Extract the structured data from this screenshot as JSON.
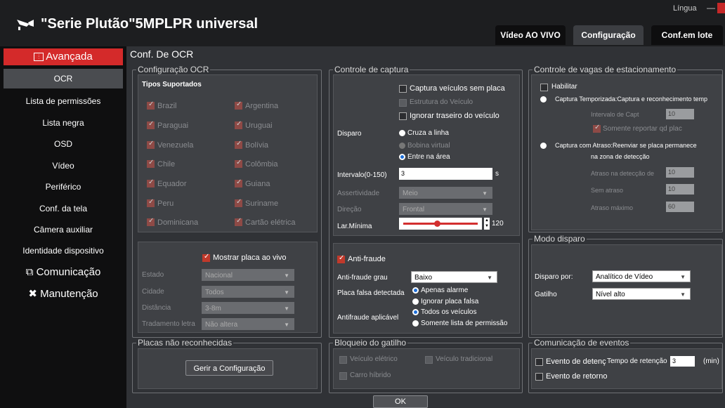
{
  "app": {
    "title": "\"Serie Plutão\"5MPLPR universal",
    "language": "Língua",
    "minimize": "—"
  },
  "tabs": [
    "Vídeo AO VIVO",
    "Configuração",
    "Conf.em lote"
  ],
  "sidebar": {
    "header": "Avançada",
    "items": [
      "OCR",
      "Lista de permissões",
      "Lista negra",
      "OSD",
      "Vídeo",
      "Periférico",
      "Conf. da tela",
      "Câmera auxiliar",
      "Identidade dispositivo",
      "Comunicação",
      "Manutenção"
    ]
  },
  "page_title": "Conf. De OCR",
  "ocr": {
    "group": "Configuração OCR",
    "types_label": "Tipos Suportados",
    "countries": [
      "Brazil",
      "Argentina",
      "Paraguai",
      "Uruguai",
      "Venezuela",
      "Bolívia",
      "Chile",
      "Colômbia",
      "Equador",
      "Guiana",
      "Peru",
      "Suriname",
      "Dominicana",
      "Cartão elétrica"
    ],
    "show_plate": "Mostrar placa ao vivo",
    "estado_label": "Estado",
    "estado_value": "Nacional",
    "cidade_label": "Cidade",
    "cidade_value": "Todos",
    "distancia_label": "Distância",
    "distancia_value": "3-8m",
    "tratamento_label": "Tradamento letra",
    "tratamento_value": "Não altera"
  },
  "unrecognized": {
    "group": "Placas não reconhecidas",
    "button": "Gerir a Configuração"
  },
  "capture": {
    "group": "Controle de captura",
    "no_plate": "Captura veículos sem placa",
    "vehicle_structure": "Estrutura do Veículo",
    "ignore_rear": "Ignorar traseiro do veículo",
    "trigger_label": "Disparo",
    "trigger_options": [
      "Cruza a linha",
      "Bobina virtual",
      "Entre na área"
    ],
    "interval_label": "Intervalo(0-150)",
    "interval_value": "3",
    "interval_unit": "s",
    "assert_label": "Assertividade",
    "assert_value": "Meio",
    "direction_label": "Direção",
    "direction_value": "Frontal",
    "minwidth_label": "Lar.Mínima",
    "minwidth_value": "120",
    "minwidth_slider": 0.45
  },
  "antifraud": {
    "label": "Anti-fraude",
    "grade_label": "Anti-fraude grau",
    "grade_value": "Baixo",
    "detected_label": "Placa falsa detectada",
    "detected_options": [
      "Apenas alarme",
      "Ignorar placa falsa"
    ],
    "applicable_label": "Antifraude aplicável",
    "applicable_options": [
      "Todos os veículos",
      "Somente lista de permissão"
    ]
  },
  "trigger_lock": {
    "group": "Bloqueio do gatilho",
    "electric": "Veículo elétrico",
    "traditional": "Veículo tradicional",
    "hybrid": "Carro híbrido"
  },
  "parking": {
    "group": "Controle de vagas de estacionamento",
    "enable": "Habilitar",
    "timed": "Captura Temporizada:Captura e reconhecimento temp",
    "capture_interval_label": "Intervalo de Capt",
    "capture_interval_value": "10",
    "only_report": "Somente reportar qd plac",
    "delayed_line1": "Captura com Atraso:Reenviar se placa permanece",
    "delayed_line2": "na zona de detecção",
    "delay_detect_label": "Atraso na detecção de",
    "delay_detect_value": "10",
    "no_delay_label": "Sem atraso",
    "no_delay_value": "10",
    "max_delay_label": "Atraso máximo",
    "max_delay_value": "60"
  },
  "trigger_mode": {
    "group": "Modo disparo",
    "by_label": "Disparo por:",
    "by_value": "Analítico de Vídeo",
    "gatilho_label": "Gatilho",
    "gatilho_value": "Nível alto"
  },
  "events": {
    "group": "Comunicação de eventos",
    "detection": "Evento de detenç",
    "retention_label": "Tempo de retenção",
    "retention_value": "3",
    "retention_unit": "(min)",
    "return": "Evento de retorno"
  },
  "ok": "OK"
}
